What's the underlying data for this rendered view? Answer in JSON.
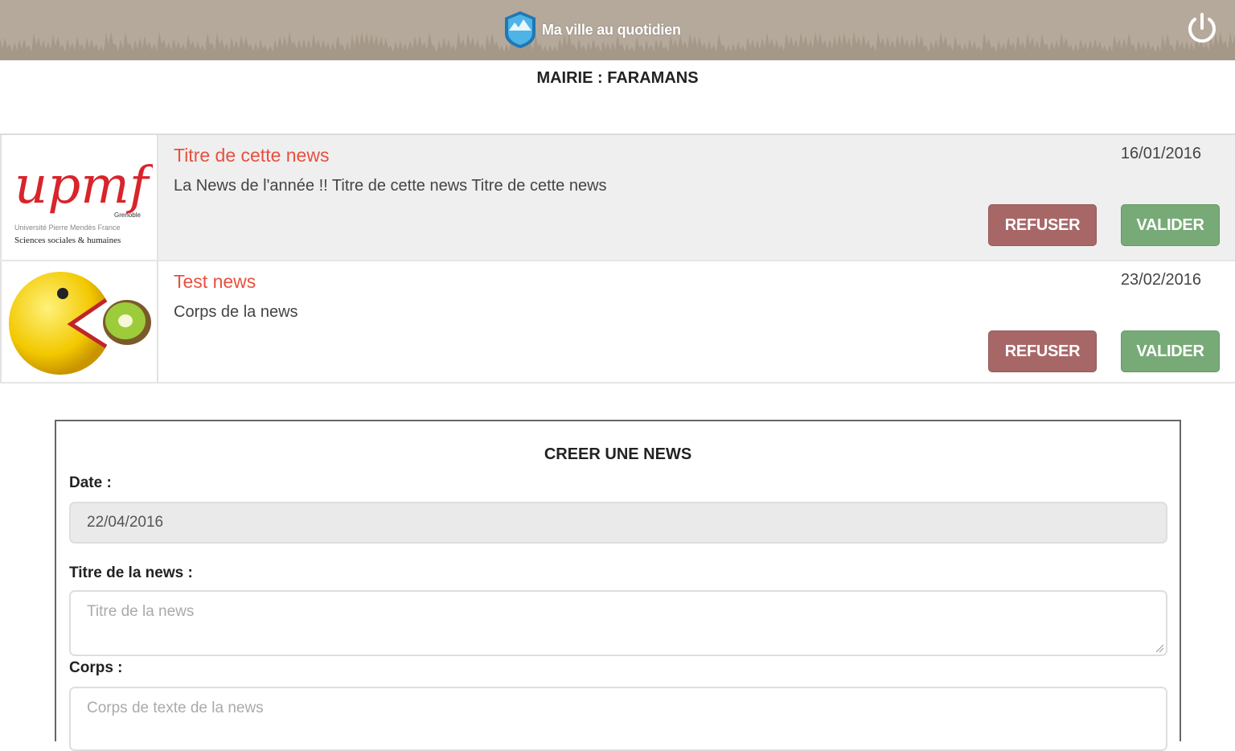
{
  "header": {
    "app_title": "Ma ville au quotidien",
    "logo_icon": "shield-logo-icon",
    "power_icon": "power-icon"
  },
  "mairie_label": "MAIRIE : FARAMANS",
  "news": [
    {
      "thumbnail": "upmf-logo",
      "title": "Titre de cette news",
      "date": "16/01/2016",
      "body": "La News de l'année !! Titre de cette news Titre de cette news",
      "refuse_label": "REFUSER",
      "validate_label": "VALIDER"
    },
    {
      "thumbnail": "pacman-kiwi-image",
      "title": "Test news",
      "date": "23/02/2016",
      "body": "Corps de la news",
      "refuse_label": "REFUSER",
      "validate_label": "VALIDER"
    }
  ],
  "form": {
    "heading": "CREER UNE NEWS",
    "date_label": "Date :",
    "date_value": "22/04/2016",
    "title_label": "Titre de la news :",
    "title_placeholder": "Titre de la news",
    "body_label": "Corps :",
    "body_placeholder": "Corps de texte de la news"
  },
  "upmf_logo": {
    "wordmark": "upmf",
    "city": "Grenoble",
    "university": "Université Pierre Mendès France",
    "tagline": "Sciences sociales & humaines"
  },
  "colors": {
    "header_bg": "#b5a99b",
    "news_title": "#e8503e",
    "refuse_button": "#a86767",
    "validate_button": "#78aa78"
  }
}
